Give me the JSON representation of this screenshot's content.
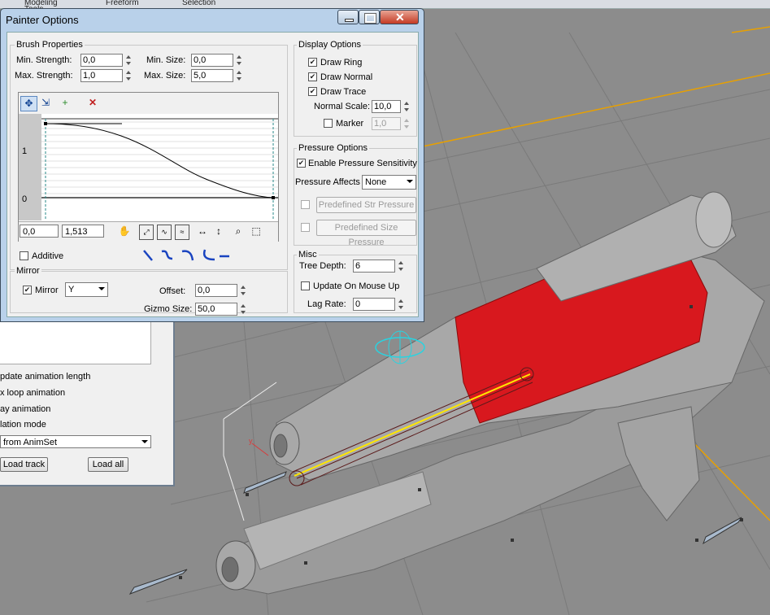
{
  "background": {
    "tabs": [
      "Modeling Tools",
      "Freeform",
      "Selection"
    ],
    "accent_color": "#e8a000",
    "model_red": "#d8181e",
    "model_gray": "#a7a7a7"
  },
  "back_panel": {
    "items": [
      "pdate animation length",
      "x loop animation",
      "ay animation",
      "lation mode"
    ],
    "dropdown_value": "from AnimSet",
    "load_track_label": "Load track",
    "load_all_label": "Load all"
  },
  "dialog": {
    "title": "Painter Options",
    "brush": {
      "group_label": "Brush Properties",
      "min_strength_label": "Min. Strength:",
      "min_strength": "0,0",
      "max_strength_label": "Max. Strength:",
      "max_strength": "1,0",
      "min_size_label": "Min. Size:",
      "min_size": "0,0",
      "max_size_label": "Max. Size:",
      "max_size": "5,0",
      "curve_tick_1": "1",
      "curve_tick_0": "0",
      "curve_x": "0,0",
      "curve_y": "1,513",
      "additive_label": "Additive"
    },
    "mirror": {
      "group_label": "Mirror",
      "mirror_label": "Mirror",
      "axis": "Y",
      "offset_label": "Offset:",
      "offset": "0,0",
      "gizmo_label": "Gizmo Size:",
      "gizmo": "50,0"
    },
    "display": {
      "group_label": "Display Options",
      "draw_ring": "Draw Ring",
      "draw_normal": "Draw Normal",
      "draw_trace": "Draw Trace",
      "normal_scale_label": "Normal Scale:",
      "normal_scale": "10,0",
      "marker_label": "Marker",
      "marker_value": "1,0"
    },
    "pressure": {
      "group_label": "Pressure Options",
      "enable_label": "Enable Pressure Sensitivity",
      "affects_label": "Pressure Affects",
      "affects_value": "None",
      "predef_str": "Predefined Str Pressure",
      "predef_size": "Predefined Size Pressure"
    },
    "misc": {
      "group_label": "Misc",
      "tree_depth_label": "Tree Depth:",
      "tree_depth": "6",
      "update_label": "Update On Mouse Up",
      "lag_label": "Lag Rate:",
      "lag_rate": "0"
    }
  }
}
